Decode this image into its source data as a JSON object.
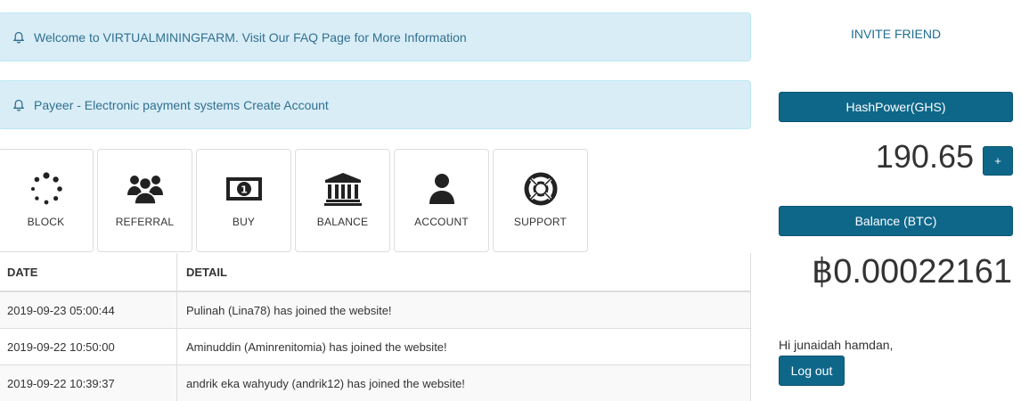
{
  "alerts": [
    {
      "text": "Welcome to VIRTUALMININGFARM. Visit Our",
      "link": "FAQ Page",
      "suffix": "for More Information"
    },
    {
      "text": "Payeer - Electronic payment systems",
      "link": "Create Account",
      "suffix": ""
    }
  ],
  "tiles": [
    {
      "label": "BLOCK",
      "icon": "spinner-icon"
    },
    {
      "label": "REFERRAL",
      "icon": "users-icon"
    },
    {
      "label": "BUY",
      "icon": "money-icon"
    },
    {
      "label": "BALANCE",
      "icon": "bank-icon"
    },
    {
      "label": "ACCOUNT",
      "icon": "user-icon"
    },
    {
      "label": "SUPPORT",
      "icon": "lifebuoy-icon"
    }
  ],
  "table": {
    "headers": [
      "DATE",
      "DETAIL"
    ],
    "rows": [
      [
        "2019-09-23 05:00:44",
        "Pulinah (Lina78) has joined the website!"
      ],
      [
        "2019-09-22 10:50:00",
        "Aminuddin (Aminrenitomia) has joined the website!"
      ],
      [
        "2019-09-22 10:39:37",
        "andrik eka wahyudy (andrik12) has joined the website!"
      ]
    ]
  },
  "sidebar": {
    "invite_label": "INVITE FRIEND",
    "hashpower_label": "HashPower(GHS)",
    "hashpower_value": "190.65",
    "plus_label": "+",
    "balance_label": "Balance (BTC)",
    "balance_value": "฿0.00022161",
    "greeting": "Hi junaidah hamdan,",
    "logout_label": "Log out"
  },
  "colors": {
    "accent": "#0e6789",
    "alert_bg": "#d9edf7",
    "alert_text": "#31708f"
  }
}
